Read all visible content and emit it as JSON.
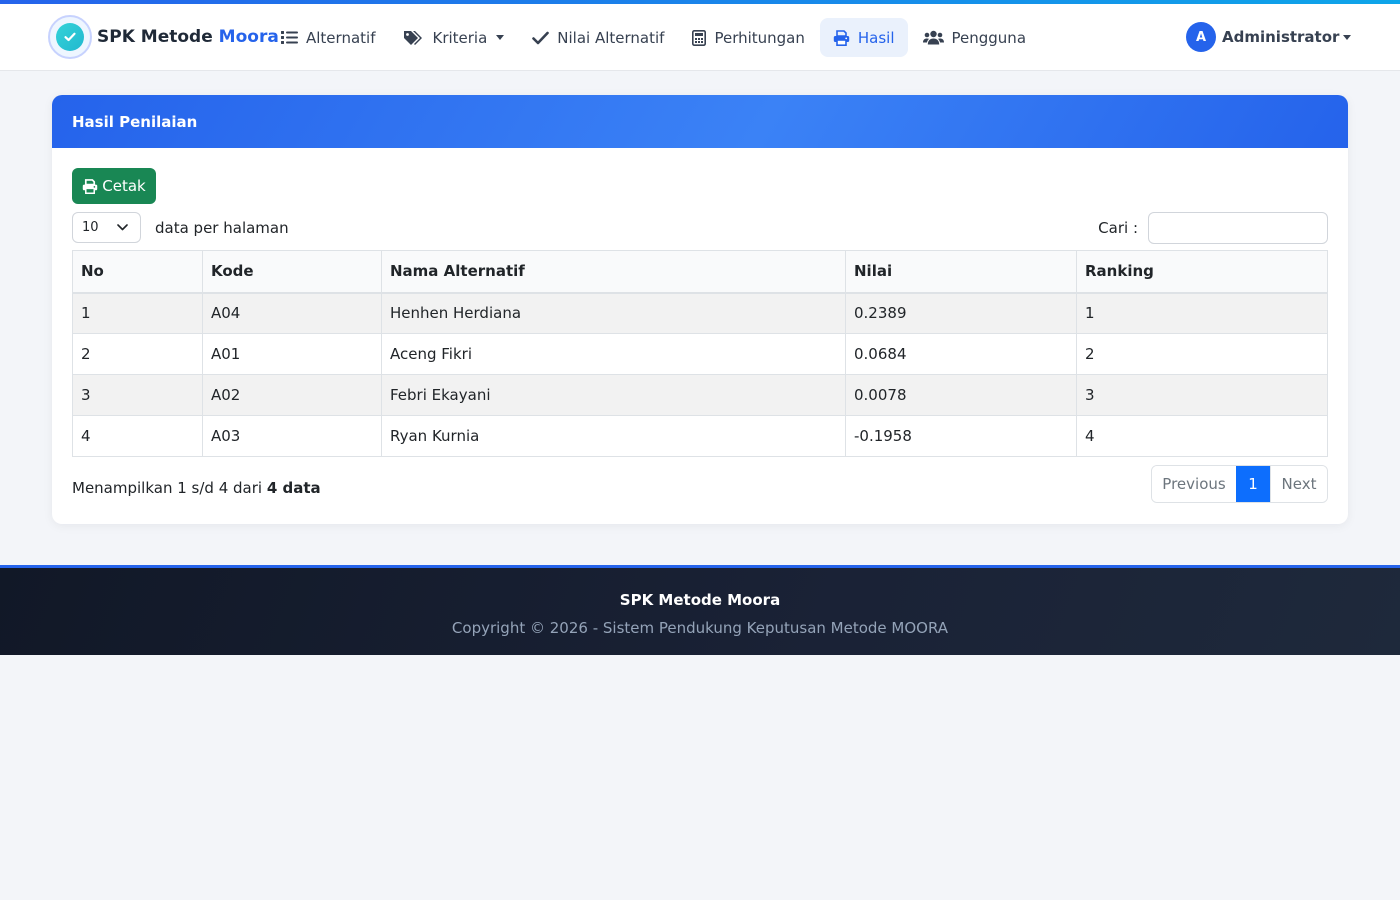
{
  "brand": {
    "name_prefix": "SPK Metode",
    "name_accent": "Moora"
  },
  "nav": {
    "items": [
      {
        "label": "Alternatif",
        "icon": "list-icon",
        "dropdown": false,
        "active": false
      },
      {
        "label": "Kriteria",
        "icon": "tags-icon",
        "dropdown": true,
        "active": false
      },
      {
        "label": "Nilai Alternatif",
        "icon": "check-icon",
        "dropdown": false,
        "active": false
      },
      {
        "label": "Perhitungan",
        "icon": "calculator-icon",
        "dropdown": false,
        "active": false
      },
      {
        "label": "Hasil",
        "icon": "print-icon",
        "dropdown": false,
        "active": true
      },
      {
        "label": "Pengguna",
        "icon": "users-icon",
        "dropdown": false,
        "active": false
      }
    ]
  },
  "user": {
    "initial": "A",
    "name": "Administrator"
  },
  "card": {
    "title": "Hasil Penilaian",
    "print_label": "Cetak",
    "page_length": "10",
    "page_length_label": "data per halaman",
    "search_label": "Cari :",
    "search_value": ""
  },
  "table": {
    "columns": [
      "No",
      "Kode",
      "Nama Alternatif",
      "Nilai",
      "Ranking"
    ],
    "rows": [
      [
        "1",
        "A04",
        "Henhen Herdiana",
        "0.2389",
        "1"
      ],
      [
        "2",
        "A01",
        "Aceng Fikri",
        "0.0684",
        "2"
      ],
      [
        "3",
        "A02",
        "Febri Ekayani",
        "0.0078",
        "3"
      ],
      [
        "4",
        "A03",
        "Ryan Kurnia",
        "-0.1958",
        "4"
      ]
    ]
  },
  "info": {
    "prefix": "Menampilkan 1 s/d 4 dari",
    "total": "4 data"
  },
  "pagination": {
    "previous": "Previous",
    "current": "1",
    "next": "Next"
  },
  "footer": {
    "title": "SPK Metode Moora",
    "copyright": "Copyright © 2026 - Sistem Pendukung Keputusan Metode MOORA"
  },
  "colors": {
    "primary": "#2563eb",
    "success": "#198754",
    "page_active": "#0d6efd",
    "footer_bg": "#111827"
  }
}
